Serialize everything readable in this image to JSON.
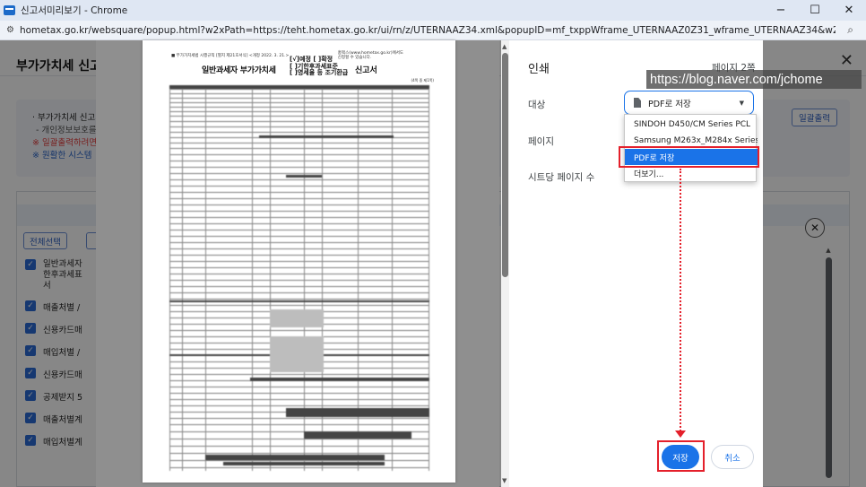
{
  "window": {
    "title": "신고서미리보기 - Chrome",
    "controls": {
      "minimize": "−",
      "maximize": "☐",
      "close": "✕"
    }
  },
  "address_bar": {
    "url": "hometax.go.kr/websquare/popup.html?w2xPath=https://teht.hometax.go.kr/ui/rn/z/UTERNAAZ34.xml&popupID=mf_txppWframe_UTERNAAZ0Z31_wframe_UTERNAAZ34&w2xHome=/ui/p...",
    "site_icon": "tune-icon",
    "zoom_icon": "zoom-icon"
  },
  "background_page": {
    "title": "부가가치세 신고",
    "close": "✕",
    "info": {
      "line1": "· 부가가치세 신고서",
      "line2": "- 개인정보보호를",
      "line3": "※ 일괄출력하려면",
      "line4": "※ 원활한 시스템"
    },
    "print_all_button": "일괄출력",
    "select_all_button": "전체선택",
    "check_items": [
      "일반과세자\n한후과세표\n서",
      "매출처별 /",
      "신용카드매",
      "매입처별 /",
      "신용카드매",
      "공제받지 5",
      "매출처별계",
      "매입처별계"
    ],
    "colors": {
      "warning": "#e23b3b",
      "notice": "#2a65c9",
      "accent": "#2a6bd6"
    }
  },
  "document_preview": {
    "header_small": "■ 부가가치세법 시행규칙 [별지 제21호서식] <개정 2022. 3. 21.>",
    "header_right": "홈택스(www.hometax.go.kr)에서도\n신청할 수 있습니다.",
    "title": "일반과세자 부가가치세",
    "options": "[√]예정 [ ]확정\n[ ]기한후과세표준\n[ ]영세율 등 조기환급",
    "title_suffix": "신고서",
    "page_note": "(4쪽 중 제1쪽)"
  },
  "print_dialog": {
    "title": "인쇄",
    "page_count": "페이지 2쪽",
    "labels": {
      "destination": "대상",
      "pages": "페이지",
      "pages_per_sheet": "시트당 페이지 수"
    },
    "destination_value": "PDF로 저장",
    "destination_options": [
      "SINDOH D450/CM Series PCL",
      "Samsung M263x_M284x Series",
      "PDF로 저장",
      "더보기..."
    ],
    "selected_option_index": 2,
    "save_button": "저장",
    "cancel_button": "취소",
    "colors": {
      "primary": "#1a73e8",
      "highlight": "#e4202b"
    }
  },
  "watermark": "https://blog.naver.com/jchome"
}
